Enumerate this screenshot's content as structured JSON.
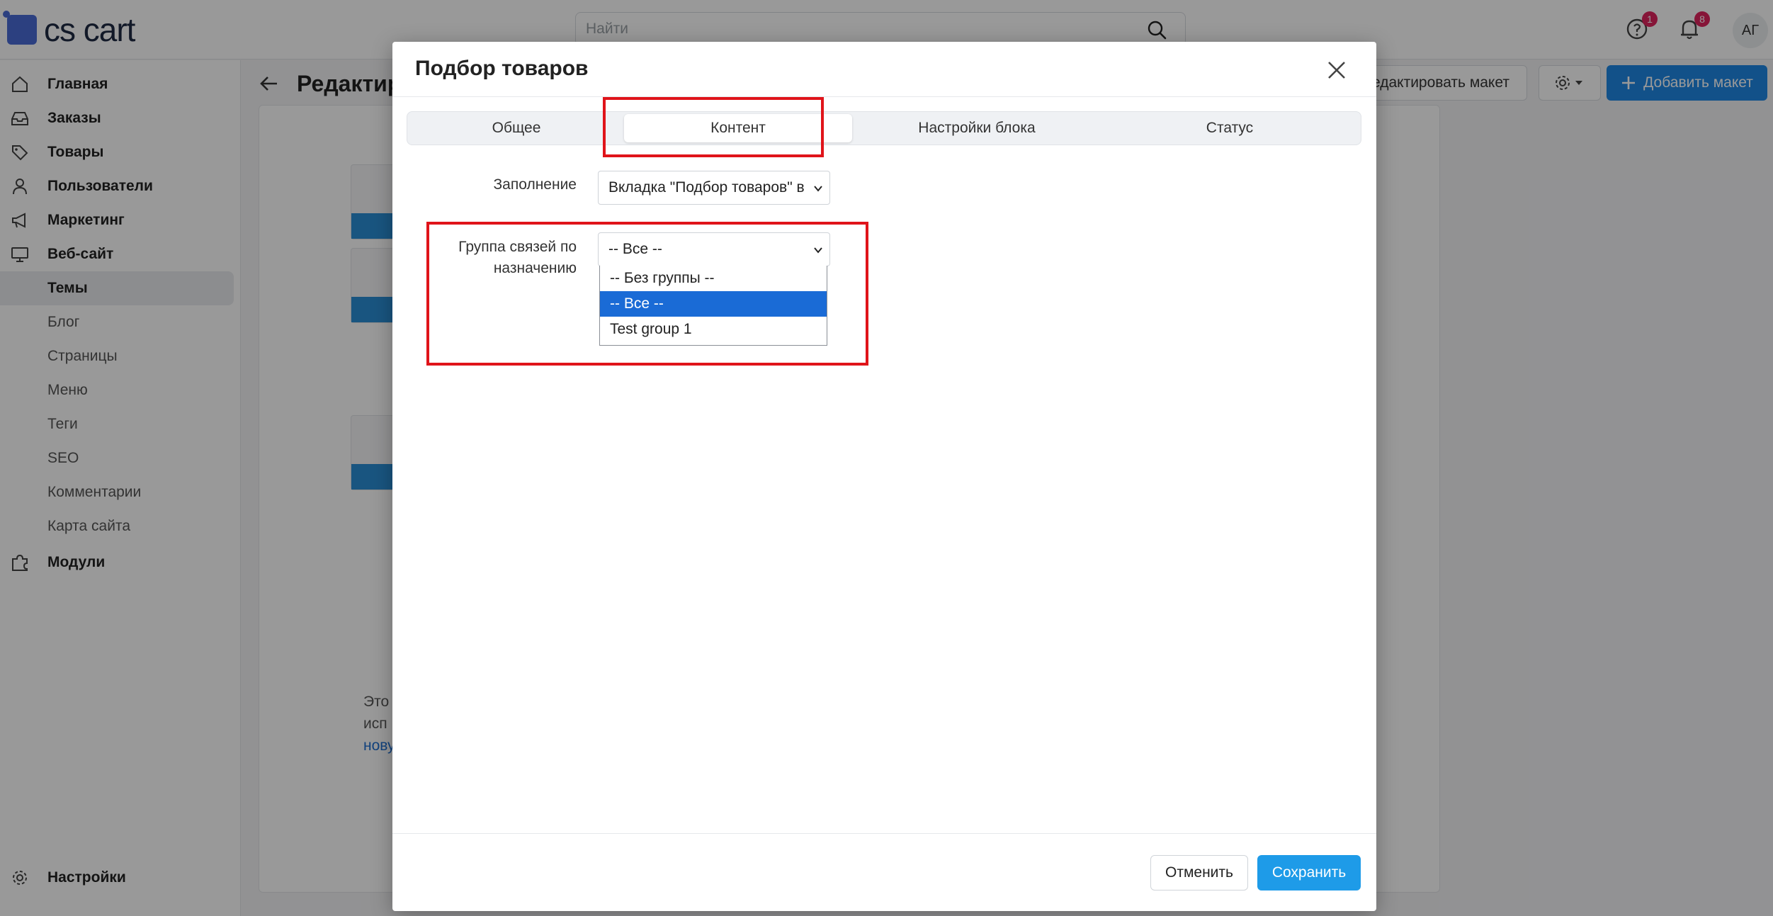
{
  "app": {
    "logo_text": "cs cart"
  },
  "topbar": {
    "search_placeholder": "Найти",
    "help_badge": "1",
    "notifications_badge": "8",
    "avatar_initials": "АГ"
  },
  "sidebar": {
    "items": [
      {
        "label": "Главная",
        "icon": "home-icon"
      },
      {
        "label": "Заказы",
        "icon": "inbox-icon"
      },
      {
        "label": "Товары",
        "icon": "tag-icon"
      },
      {
        "label": "Пользователи",
        "icon": "user-icon"
      },
      {
        "label": "Маркетинг",
        "icon": "megaphone-icon"
      },
      {
        "label": "Веб-сайт",
        "icon": "monitor-icon"
      },
      {
        "label": "Темы"
      },
      {
        "label": "Блог"
      },
      {
        "label": "Страницы"
      },
      {
        "label": "Меню"
      },
      {
        "label": "Теги"
      },
      {
        "label": "SEO"
      },
      {
        "label": "Комментарии"
      },
      {
        "label": "Карта сайта"
      },
      {
        "label": "Модули",
        "icon": "puzzle-icon"
      },
      {
        "label": "Настройки",
        "icon": "gear-icon"
      }
    ],
    "active_item": "Темы"
  },
  "page": {
    "title": "Редактир",
    "edit_layout_label": "едактировать макет",
    "add_layout_label": "Добавить макет",
    "hint_line1": "Это",
    "hint_line2": "исп",
    "hint_link": "нову"
  },
  "modal": {
    "title": "Подбор товаров",
    "tabs": [
      "Общее",
      "Контент",
      "Настройки блока",
      "Статус"
    ],
    "active_tab": "Контент",
    "fill_label": "Заполнение",
    "fill_value": "Вкладка \"Подбор товаров\" в",
    "group_label_line1": "Группа связей по",
    "group_label_line2": "назначению",
    "group_value": "-- Все --",
    "group_options": [
      "-- Без группы --",
      "-- Все --",
      "Test group 1"
    ],
    "group_selected_option": "-- Все --",
    "cancel_label": "Отменить",
    "save_label": "Сохранить"
  },
  "colors": {
    "accent": "#1e9be8",
    "highlight_box": "#e0141a",
    "selected_option": "#1a6bd6"
  }
}
